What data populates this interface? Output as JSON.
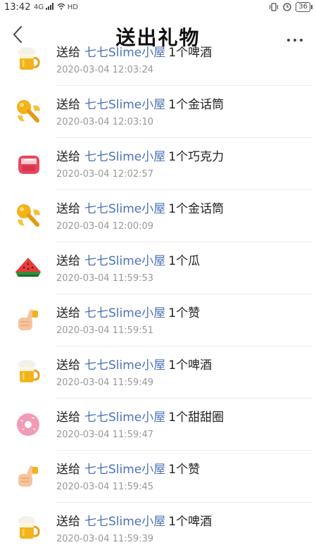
{
  "status": {
    "time": "13:42",
    "signal": "4G",
    "network": "HD",
    "battery": "36"
  },
  "header": {
    "title": "送出礼物"
  },
  "list": {
    "items": [
      {
        "to": "送给",
        "recipient": "七七Slime小屋",
        "gift": "1个啤酒",
        "time": "2020-03-04 12:03:24",
        "icon": "beer-icon"
      },
      {
        "to": "送给",
        "recipient": "七七Slime小屋",
        "gift": "1个金话筒",
        "time": "2020-03-04 12:03:10",
        "icon": "golden-mic-icon"
      },
      {
        "to": "送给",
        "recipient": "七七Slime小屋",
        "gift": "1个巧克力",
        "time": "2020-03-04 12:02:57",
        "icon": "chocolate-icon"
      },
      {
        "to": "送给",
        "recipient": "七七Slime小屋",
        "gift": "1个金话筒",
        "time": "2020-03-04 12:00:09",
        "icon": "golden-mic-icon"
      },
      {
        "to": "送给",
        "recipient": "七七Slime小屋",
        "gift": "1个瓜",
        "time": "2020-03-04 11:59:53",
        "icon": "watermelon-icon"
      },
      {
        "to": "送给",
        "recipient": "七七Slime小屋",
        "gift": "1个赞",
        "time": "2020-03-04 11:59:51",
        "icon": "thumbs-up-icon"
      },
      {
        "to": "送给",
        "recipient": "七七Slime小屋",
        "gift": "1个啤酒",
        "time": "2020-03-04 11:59:49",
        "icon": "beer-icon"
      },
      {
        "to": "送给",
        "recipient": "七七Slime小屋",
        "gift": "1个甜甜圈",
        "time": "2020-03-04 11:59:47",
        "icon": "donut-icon"
      },
      {
        "to": "送给",
        "recipient": "七七Slime小屋",
        "gift": "1个赞",
        "time": "2020-03-04 11:59:45",
        "icon": "thumbs-up-icon"
      },
      {
        "to": "送给",
        "recipient": "七七Slime小屋",
        "gift": "1个啤酒",
        "time": "2020-03-04 11:59:39",
        "icon": "beer-icon"
      }
    ]
  }
}
